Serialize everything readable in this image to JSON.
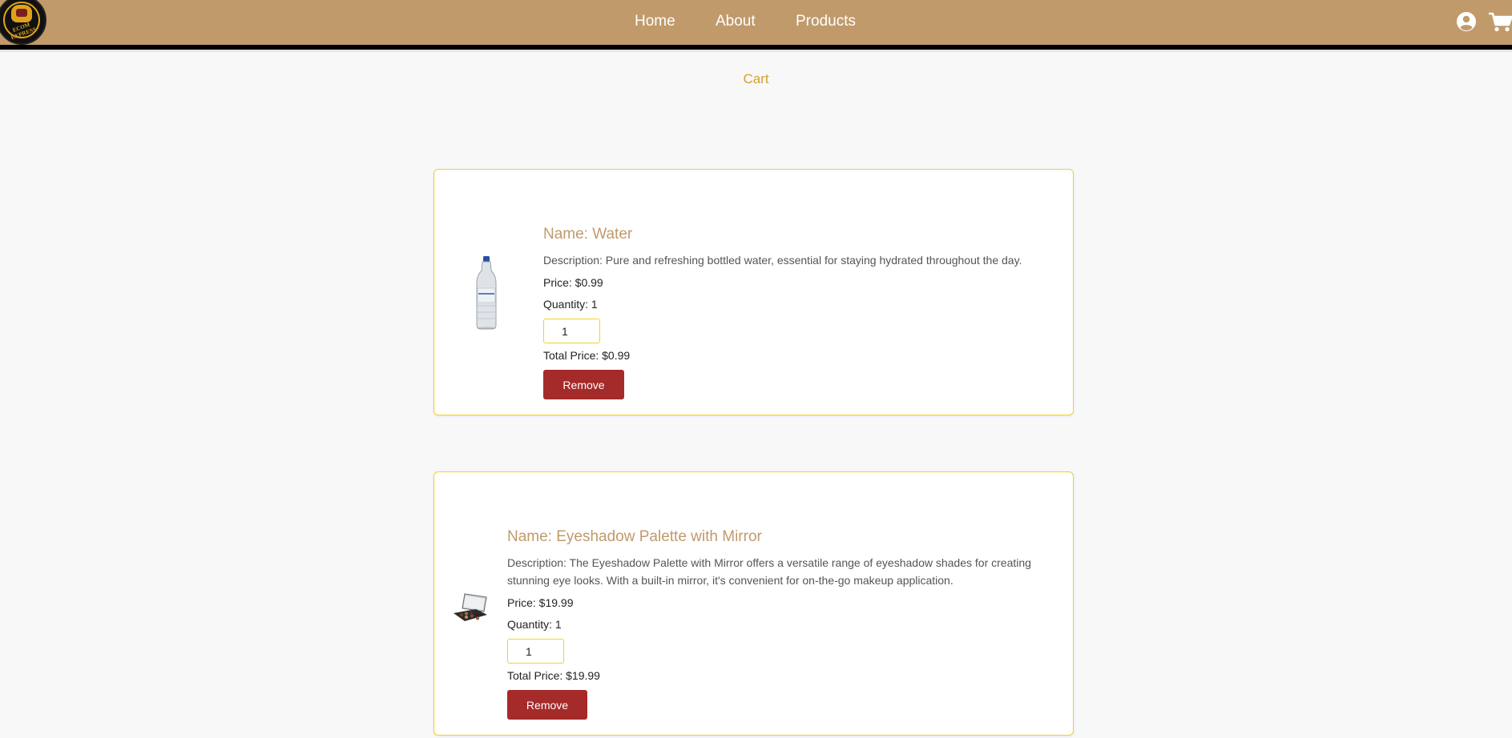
{
  "brand": {
    "logo_text": "ECOM EXPRESS",
    "color": "#c09a6b"
  },
  "nav": {
    "links": [
      "Home",
      "About",
      "Products"
    ],
    "icons": [
      "user-circle-icon",
      "cart-icon"
    ]
  },
  "page": {
    "title": "Cart"
  },
  "cart_items": [
    {
      "name": "Name: Water",
      "description": "Description: Pure and refreshing bottled water, essential for staying hydrated throughout the day.",
      "price": "Price: $0.99",
      "quantity": "Quantity: 1",
      "qty_value": "1",
      "total": "Total Price: $0.99",
      "remove_label": "Remove"
    },
    {
      "name": "Name: Eyeshadow Palette with Mirror",
      "description": "Description: The Eyeshadow Palette with Mirror offers a versatile range of eyeshadow shades for creating stunning eye looks. With a built-in mirror, it's convenient for on-the-go makeup application.",
      "price": "Price: $19.99",
      "quantity": "Quantity: 1",
      "qty_value": "1",
      "total": "Total Price: $19.99",
      "remove_label": "Remove"
    }
  ],
  "colors": {
    "accent": "#d4a32a",
    "border": "#f2d12e",
    "remove": "#a52a2a"
  }
}
